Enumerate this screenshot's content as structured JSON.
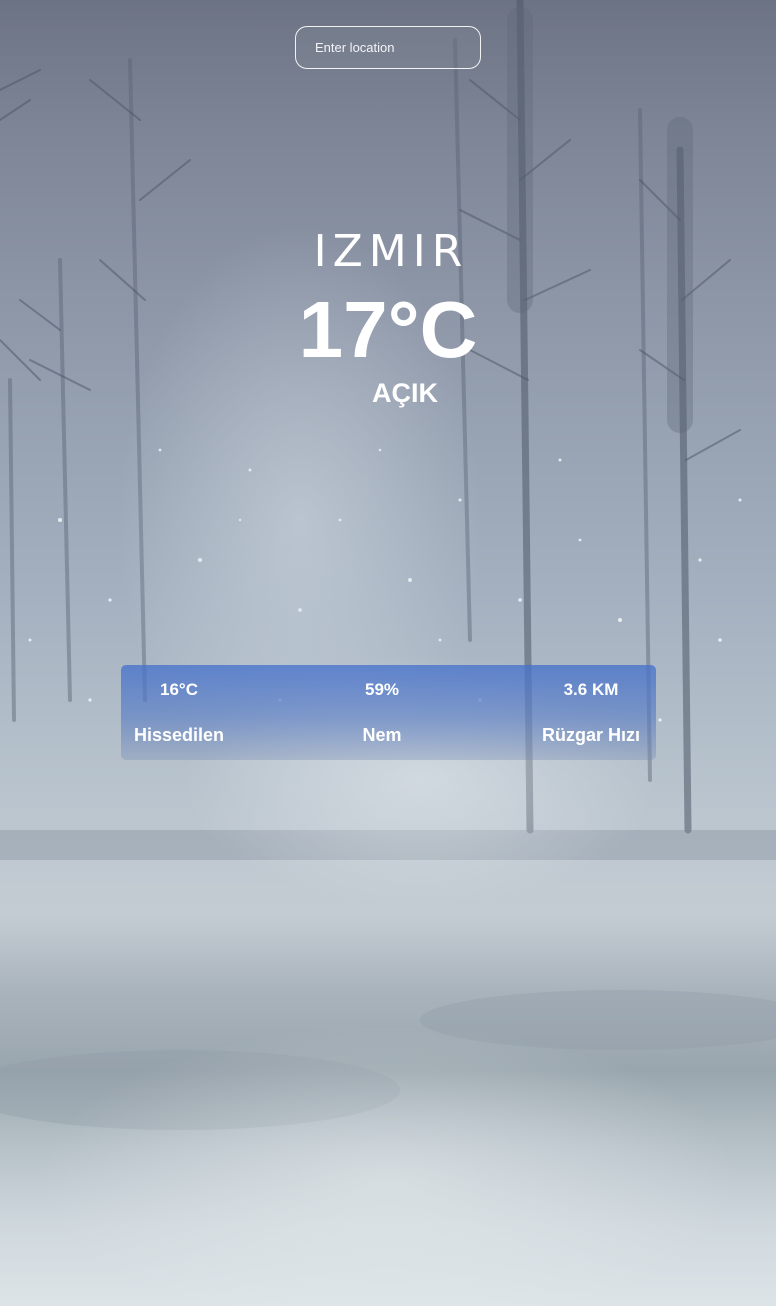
{
  "search": {
    "placeholder": "Enter location"
  },
  "weather": {
    "city": "IZMIR",
    "temperature": "17°C",
    "description": "AÇIK"
  },
  "details": {
    "feels_like": {
      "value": "16°C",
      "label": "Hissedilen"
    },
    "humidity": {
      "value": "59%",
      "label": "Nem"
    },
    "wind_speed": {
      "value": "3.6 KM",
      "label": "Rüzgar Hızı"
    }
  },
  "colors": {
    "panel_accent": "#4672cc",
    "text": "#ffffff",
    "background_snow_scene": "#9aa6b4"
  }
}
